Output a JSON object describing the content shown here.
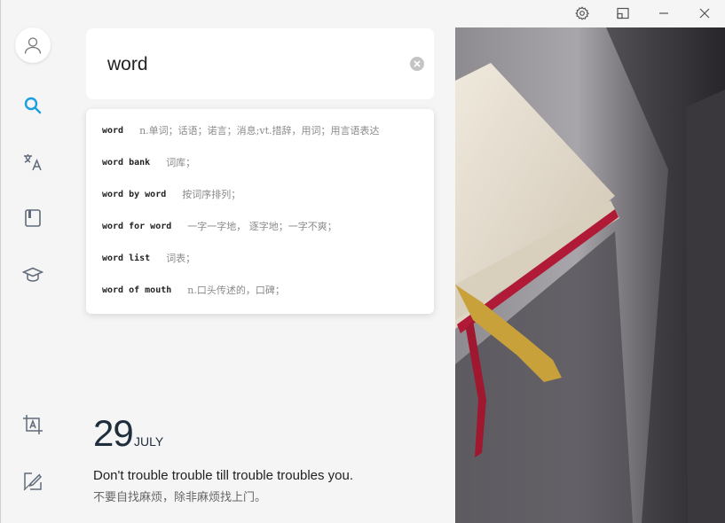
{
  "window": {
    "controls": [
      "settings-icon",
      "restore-icon",
      "minimize-icon",
      "close-icon"
    ]
  },
  "sidebar": {
    "items": [
      {
        "name": "avatar",
        "icon": "user-icon"
      },
      {
        "name": "search",
        "icon": "search-icon",
        "active": true
      },
      {
        "name": "translate",
        "icon": "translate-icon"
      },
      {
        "name": "wordbook",
        "icon": "book-icon"
      },
      {
        "name": "learn",
        "icon": "graduation-cap-icon"
      },
      {
        "name": "screenshot-translate",
        "icon": "screenshot-text-icon"
      },
      {
        "name": "select-translate",
        "icon": "pen-select-icon"
      }
    ]
  },
  "search": {
    "value": "word",
    "placeholder": ""
  },
  "suggestions": [
    {
      "word": "word",
      "def": "n.单词；话语；诺言；消息;vt.措辞，用词；用言语表达"
    },
    {
      "word": "word bank",
      "def": "词库；"
    },
    {
      "word": "word by word",
      "def": "按词序排列；"
    },
    {
      "word": "word for word",
      "def": "一字一字地， 逐字地；一字不爽；"
    },
    {
      "word": "word list",
      "def": "词表；"
    },
    {
      "word": "word of mouth",
      "def": "n.口头传述的，口碑；"
    }
  ],
  "daily": {
    "day": "29",
    "month": "JULY",
    "quote_en": "Don't trouble trouble till trouble troubles you.",
    "quote_cn": "不要自找麻烦，除非麻烦找上门。"
  },
  "colors": {
    "accent": "#1a9fe0",
    "icon": "#5f6b7a",
    "text_dark": "#1f2d3d"
  }
}
